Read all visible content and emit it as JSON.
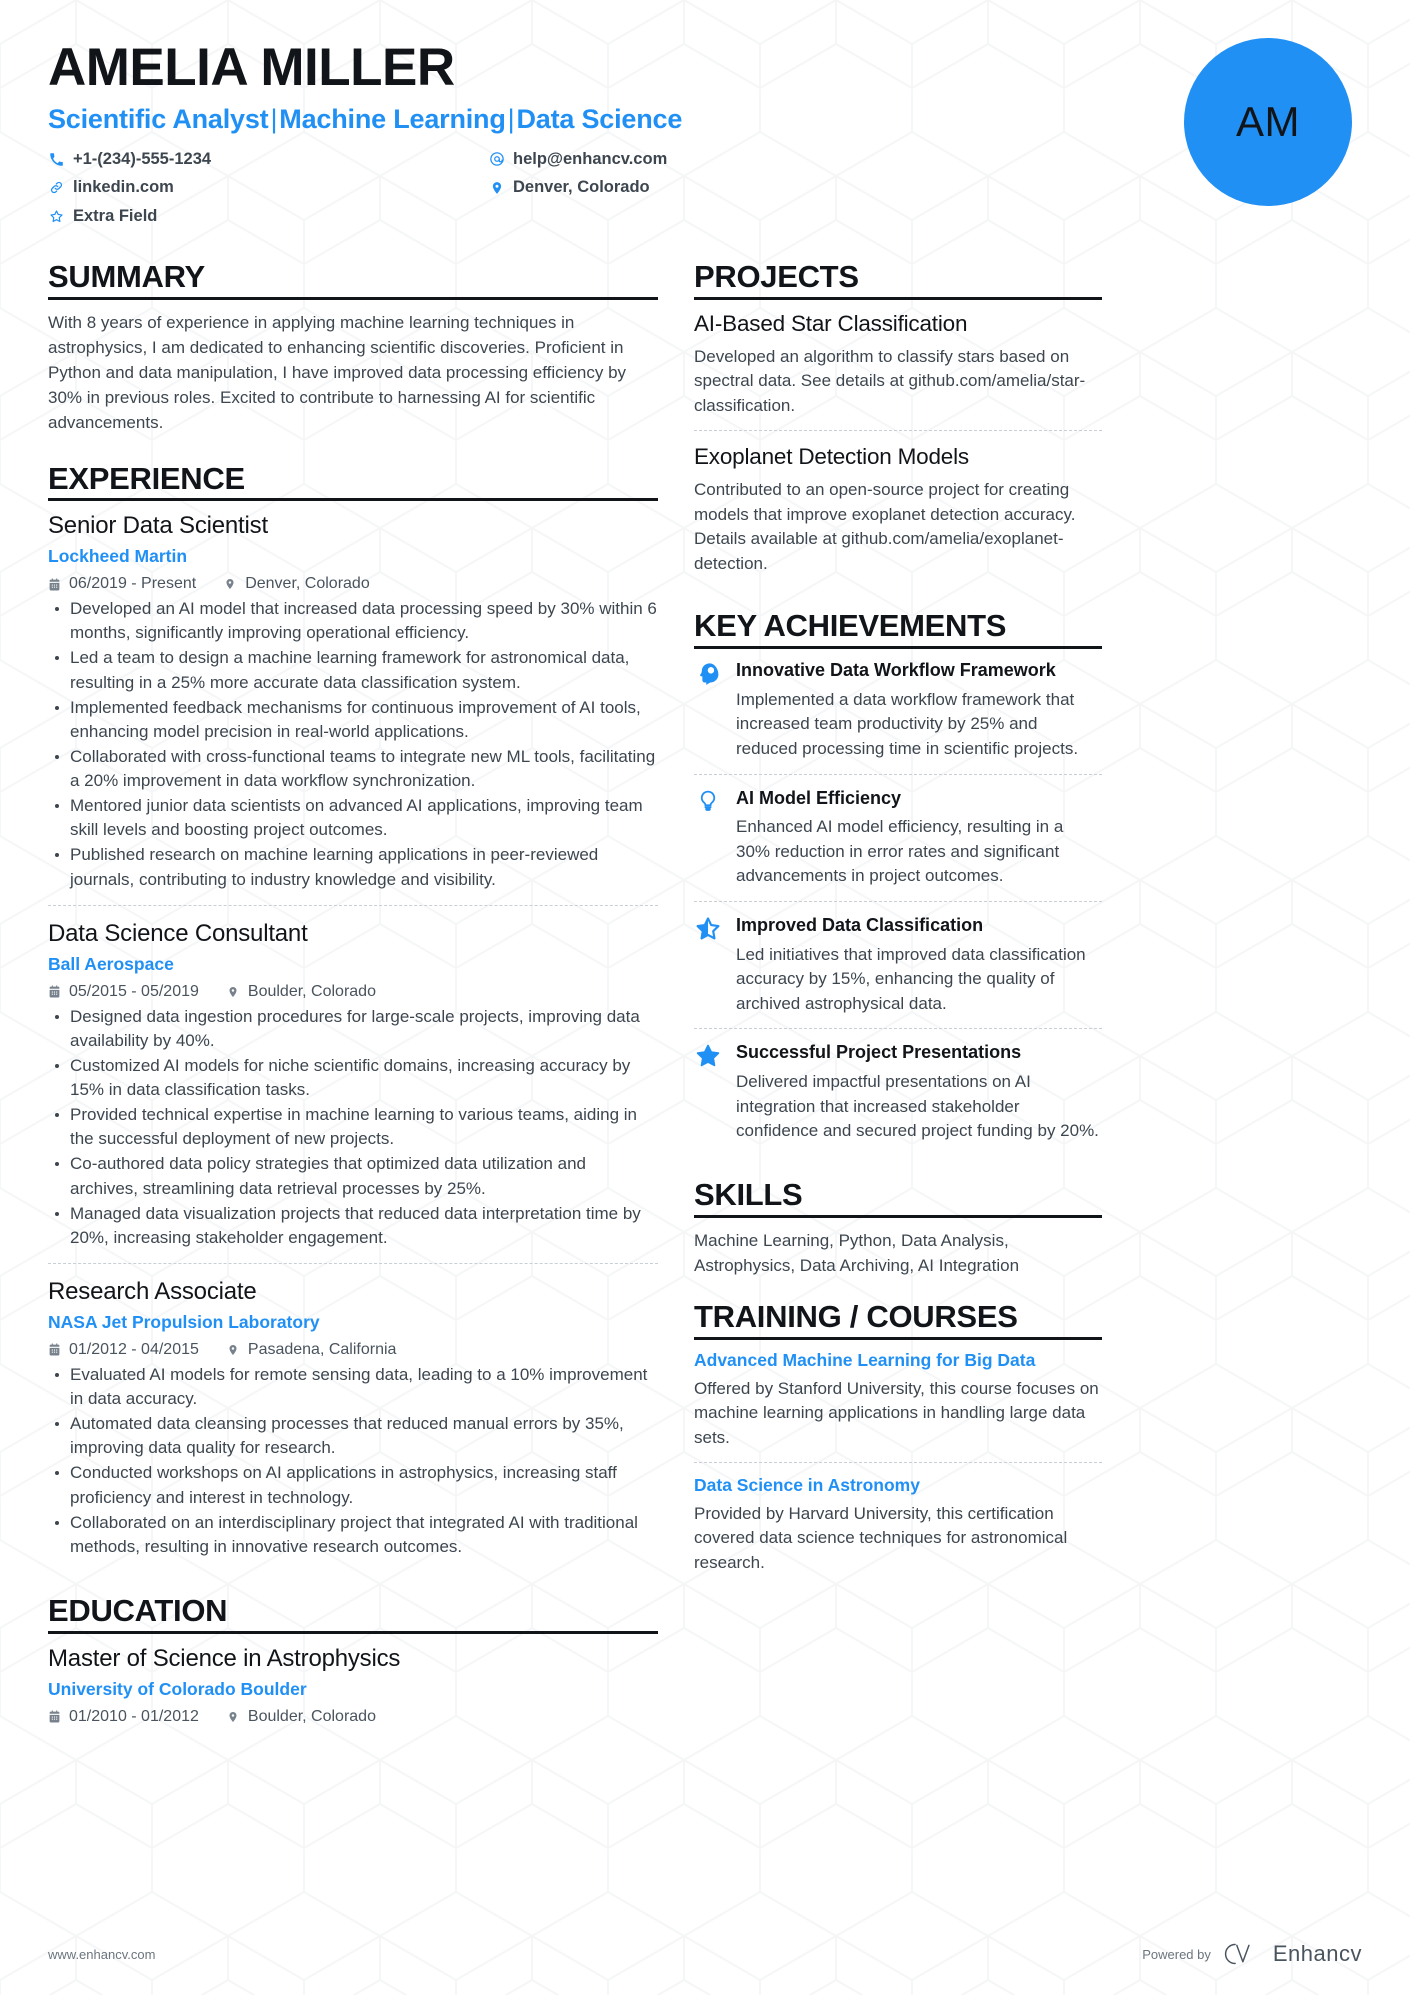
{
  "header": {
    "name": "AMELIA MILLER",
    "headline_parts": [
      "Scientific Analyst",
      "Machine Learning",
      "Data Science"
    ],
    "headline_separator": "|",
    "avatar_initials": "AM",
    "accent_color": "#2190f5",
    "contacts": [
      {
        "icon": "phone-icon",
        "value": "+1-(234)-555-1234"
      },
      {
        "icon": "email-icon",
        "value": "help@enhancv.com"
      },
      {
        "icon": "link-icon",
        "value": "linkedin.com"
      },
      {
        "icon": "location-icon",
        "value": "Denver, Colorado"
      },
      {
        "icon": "star-icon",
        "value": "Extra Field"
      }
    ]
  },
  "summary": {
    "heading": "SUMMARY",
    "text": "With 8 years of experience in applying machine learning techniques in astrophysics, I am dedicated to enhancing scientific discoveries. Proficient in Python and data manipulation, I have improved data processing efficiency by 30% in previous roles. Excited to contribute to harnessing AI for scientific advancements."
  },
  "experience": {
    "heading": "EXPERIENCE",
    "entries": [
      {
        "title": "Senior Data Scientist",
        "org": "Lockheed Martin",
        "dates": "06/2019 - Present",
        "location": "Denver, Colorado",
        "bullets": [
          "Developed an AI model that increased data processing speed by 30% within 6 months, significantly improving operational efficiency.",
          "Led a team to design a machine learning framework for astronomical data, resulting in a 25% more accurate data classification system.",
          "Implemented feedback mechanisms for continuous improvement of AI tools, enhancing model precision in real-world applications.",
          "Collaborated with cross-functional teams to integrate new ML tools, facilitating a 20% improvement in data workflow synchronization.",
          "Mentored junior data scientists on advanced AI applications, improving team skill levels and boosting project outcomes.",
          "Published research on machine learning applications in peer-reviewed journals, contributing to industry knowledge and visibility."
        ]
      },
      {
        "title": "Data Science Consultant",
        "org": "Ball Aerospace",
        "dates": "05/2015 - 05/2019",
        "location": "Boulder, Colorado",
        "bullets": [
          "Designed data ingestion procedures for large-scale projects, improving data availability by 40%.",
          "Customized AI models for niche scientific domains, increasing accuracy by 15% in data classification tasks.",
          "Provided technical expertise in machine learning to various teams, aiding in the successful deployment of new projects.",
          "Co-authored data policy strategies that optimized data utilization and archives, streamlining data retrieval processes by 25%.",
          "Managed data visualization projects that reduced data interpretation time by 20%, increasing stakeholder engagement."
        ]
      },
      {
        "title": "Research Associate",
        "org": "NASA Jet Propulsion Laboratory",
        "dates": "01/2012 - 04/2015",
        "location": "Pasadena, California",
        "bullets": [
          "Evaluated AI models for remote sensing data, leading to a 10% improvement in data accuracy.",
          "Automated data cleansing processes that reduced manual errors by 35%, improving data quality for research.",
          "Conducted workshops on AI applications in astrophysics, increasing staff proficiency and interest in technology.",
          "Collaborated on an interdisciplinary project that integrated AI with traditional methods, resulting in innovative research outcomes."
        ]
      }
    ]
  },
  "education": {
    "heading": "EDUCATION",
    "entries": [
      {
        "title": "Master of Science in Astrophysics",
        "org": "University of Colorado Boulder",
        "dates": "01/2010 - 01/2012",
        "location": "Boulder, Colorado"
      }
    ]
  },
  "projects": {
    "heading": "PROJECTS",
    "items": [
      {
        "title": "AI-Based Star Classification",
        "description": "Developed an algorithm to classify stars based on spectral data. See details at github.com/amelia/star-classification."
      },
      {
        "title": "Exoplanet Detection Models",
        "description": "Contributed to an open-source project for creating models that improve exoplanet detection accuracy. Details available at github.com/amelia/exoplanet-detection."
      }
    ]
  },
  "achievements": {
    "heading": "KEY ACHIEVEMENTS",
    "items": [
      {
        "icon": "head-brain-icon",
        "title": "Innovative Data Workflow Framework",
        "description": "Implemented a data workflow framework that increased team productivity by 25% and reduced processing time in scientific projects."
      },
      {
        "icon": "lightbulb-icon",
        "title": "AI Model Efficiency",
        "description": "Enhanced AI model efficiency, resulting in a 30% reduction in error rates and significant advancements in project outcomes."
      },
      {
        "icon": "half-star-icon",
        "title": "Improved Data Classification",
        "description": "Led initiatives that improved data classification accuracy by 15%, enhancing the quality of archived astrophysical data."
      },
      {
        "icon": "star-filled-icon",
        "title": "Successful Project Presentations",
        "description": "Delivered impactful presentations on AI integration that increased stakeholder confidence and secured project funding by 20%."
      }
    ]
  },
  "skills": {
    "heading": "SKILLS",
    "text": "Machine Learning, Python, Data Analysis, Astrophysics, Data Archiving, AI Integration"
  },
  "training": {
    "heading": "TRAINING / COURSES",
    "items": [
      {
        "title": "Advanced Machine Learning for Big Data",
        "description": "Offered by Stanford University, this course focuses on machine learning applications in handling large data sets."
      },
      {
        "title": "Data Science in Astronomy",
        "description": "Provided by Harvard University, this certification covered data science techniques for astronomical research."
      }
    ]
  },
  "footer": {
    "url": "www.enhancv.com",
    "powered_by": "Powered by",
    "brand": "Enhancv"
  }
}
